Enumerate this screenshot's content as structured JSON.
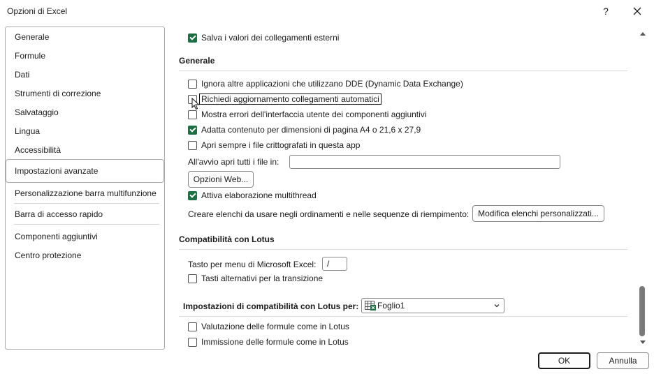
{
  "window": {
    "title": "Opzioni di Excel",
    "help_label": "?"
  },
  "sidebar": {
    "items": [
      {
        "label": "Generale"
      },
      {
        "label": "Formule"
      },
      {
        "label": "Dati"
      },
      {
        "label": "Strumenti di correzione"
      },
      {
        "label": "Salvataggio"
      },
      {
        "label": "Lingua"
      },
      {
        "label": "Accessibilità"
      },
      {
        "label": "Impostazioni avanzate",
        "selected": true
      },
      {
        "label": "Personalizzazione barra multifunzione"
      },
      {
        "label": "Barra di accesso rapido"
      },
      {
        "label": "Componenti aggiuntivi"
      },
      {
        "label": "Centro protezione"
      }
    ]
  },
  "content": {
    "top_option": {
      "label": "Salva i valori dei collegamenti esterni",
      "checked": true
    },
    "generale": {
      "heading": "Generale",
      "options": [
        {
          "label": "Ignora altre applicazioni che utilizzano DDE (Dynamic Data Exchange)",
          "checked": false
        },
        {
          "label": "Richiedi aggiornamento collegamenti automatici",
          "checked": false
        },
        {
          "label": "Mostra errori dell'interfaccia utente dei componenti aggiuntivi",
          "checked": false
        },
        {
          "label": "Adatta contenuto per dimensioni di pagina A4 o 21,6 x 27,9",
          "checked": true
        },
        {
          "label": "Apri sempre i file crittografati in questa app",
          "checked": false
        }
      ],
      "startup_label": "All'avvio apri tutti i file in:",
      "startup_value": "",
      "web_options_button": "Opzioni Web...",
      "multithread": {
        "label": "Attiva elaborazione multithread",
        "checked": true
      },
      "lists_label": "Creare elenchi da usare negli ordinamenti e nelle sequenze di riempimento:",
      "lists_button": "Modifica elenchi personalizzati..."
    },
    "lotus": {
      "heading": "Compatibilità con Lotus",
      "menu_key_label": "Tasto per menu di Microsoft Excel:",
      "menu_key_value": "/",
      "alt_keys": {
        "label": "Tasti alternativi per la transizione",
        "checked": false
      }
    },
    "lotus_settings": {
      "heading": "Impostazioni di compatibilità con Lotus per:",
      "sheet_selected": "Foglio1",
      "options": [
        {
          "label": "Valutazione delle formule come in Lotus",
          "checked": false
        },
        {
          "label": "Immissione delle formule come in Lotus",
          "checked": false
        }
      ]
    }
  },
  "footer": {
    "ok": "OK",
    "cancel": "Annulla"
  },
  "colors": {
    "accent": "#1e6e43",
    "border": "#a9a9a9"
  }
}
